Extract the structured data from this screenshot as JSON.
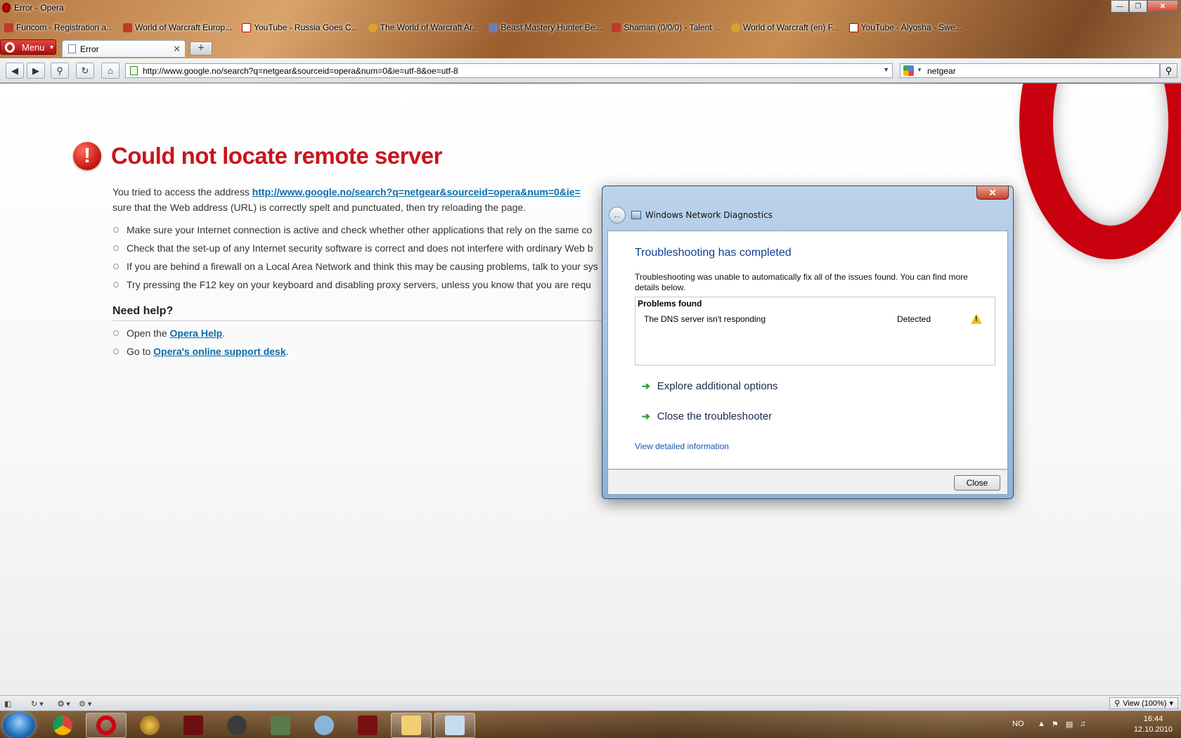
{
  "window": {
    "title": "Error - Opera"
  },
  "bookmarks": [
    {
      "label": "Funcom - Registration a...",
      "icon": "funcom-icon"
    },
    {
      "label": "World of Warcraft Europ...",
      "icon": "wow-icon"
    },
    {
      "label": "YouTube - Russia Goes C...",
      "icon": "youtube-icon"
    },
    {
      "label": "The World of Warcraft Ar...",
      "icon": "armory-icon"
    },
    {
      "label": "Beast Mastery Hunter Be...",
      "icon": "star-icon"
    },
    {
      "label": "Shaman (0/0/0) - Talent ...",
      "icon": "shaman-icon"
    },
    {
      "label": "World of Warcraft (en) F...",
      "icon": "forum-icon"
    },
    {
      "label": "YouTube - Alyosha - Swe...",
      "icon": "youtube-icon"
    }
  ],
  "tabs": {
    "menu_label": "Menu",
    "active_tab": "Error",
    "new_tab_symbol": "+"
  },
  "address": {
    "url": "http://www.google.no/search?q=netgear&sourceid=opera&num=0&ie=utf-8&oe=utf-8",
    "search_value": "netgear"
  },
  "error_page": {
    "title": "Could not locate remote server",
    "intro_prefix": "You tried to access the address ",
    "intro_link": "http://www.google.no/search?q=netgear&sourceid=opera&num=0&ie=",
    "intro_suffix": "sure that the Web address (URL) is correctly spelt and punctuated, then try reloading the page.",
    "tips": [
      "Make sure your Internet connection is active and check whether other applications that rely on the same co",
      "Check that the set-up of any Internet security software is correct and does not interfere with ordinary Web b",
      "If you are behind a firewall on a Local Area Network and think this may be causing problems, talk to your sys",
      "Try pressing the F12 key on your keyboard and disabling proxy servers, unless you know that you are requ"
    ],
    "help_title": "Need help?",
    "help": [
      {
        "prefix": "Open the ",
        "link": "Opera Help",
        "suffix": "."
      },
      {
        "prefix": "Go to ",
        "link": "Opera's online support desk",
        "suffix": "."
      }
    ]
  },
  "dialog": {
    "app_title": "Windows Network Diagnostics",
    "heading": "Troubleshooting has completed",
    "text": "Troubleshooting was unable to automatically fix all of the issues found. You can find more details below.",
    "problems_header": "Problems found",
    "problem_name": "The DNS server isn't responding",
    "problem_status": "Detected",
    "option1": "Explore additional options",
    "option2": "Close the troubleshooter",
    "detail_link": "View detailed information",
    "close_button": "Close",
    "close_x": "✕"
  },
  "statusbar": {
    "zoom": "View (100%)"
  },
  "taskbar": {
    "lang": "NO",
    "time": "16:44",
    "date": "12.10.2010",
    "apps": [
      "chrome-icon",
      "opera-icon",
      "wow-icon",
      "game-icon",
      "steam-icon",
      "network-icon",
      "users-icon",
      "game2-icon",
      "explorer-icon",
      "network-diagnostics-icon"
    ]
  },
  "colors": {
    "error_red": "#c9141c",
    "link_blue": "#0c6ca7",
    "dialog_heading": "#0f3f91"
  }
}
